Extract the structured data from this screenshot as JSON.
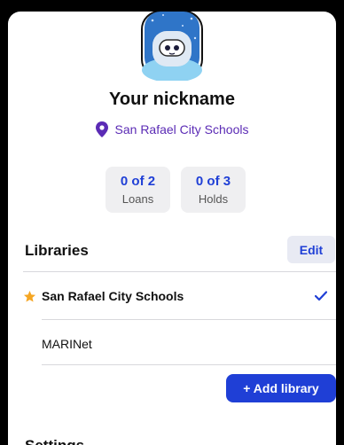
{
  "profile": {
    "nickname": "Your nickname",
    "library_name": "San Rafael City Schools"
  },
  "stats": {
    "loans_value": "0 of 2",
    "loans_label": "Loans",
    "holds_value": "0 of 3",
    "holds_label": "Holds"
  },
  "libraries": {
    "title": "Libraries",
    "edit_label": "Edit",
    "items": [
      {
        "name": "San Rafael City Schools",
        "primary": true,
        "selected": true
      },
      {
        "name": "MARINet",
        "primary": false,
        "selected": false
      }
    ],
    "add_label": "+ Add library"
  },
  "settings": {
    "title": "Settings"
  },
  "colors": {
    "accent": "#1f3fd6",
    "location": "#5b2bb5",
    "star": "#f5a623",
    "avatar_bg": "#2f75c8"
  },
  "icons": [
    "avatar-icon",
    "location-pin-icon",
    "star-icon",
    "checkmark-icon"
  ]
}
